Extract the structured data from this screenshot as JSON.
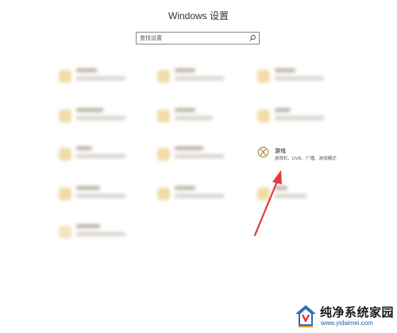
{
  "window": {
    "title": "Windows 设置"
  },
  "search": {
    "placeholder": "查找设置"
  },
  "highlight": {
    "title": "游戏",
    "description": "游戏栏、DVR、广播、游戏模式",
    "icon": "xbox-icon",
    "accent": "#a88a33"
  },
  "blurred_tiles": [
    "tile-1",
    "tile-2",
    "tile-3",
    "tile-4",
    "tile-5",
    "tile-6",
    "tile-7",
    "tile-8",
    "tile-9",
    "tile-10",
    "tile-11",
    "tile-12"
  ],
  "annotation": {
    "arrow_color": "#e23a3a"
  },
  "watermark": {
    "name": "纯净系统家园",
    "url": "www.yidaimei.com"
  }
}
